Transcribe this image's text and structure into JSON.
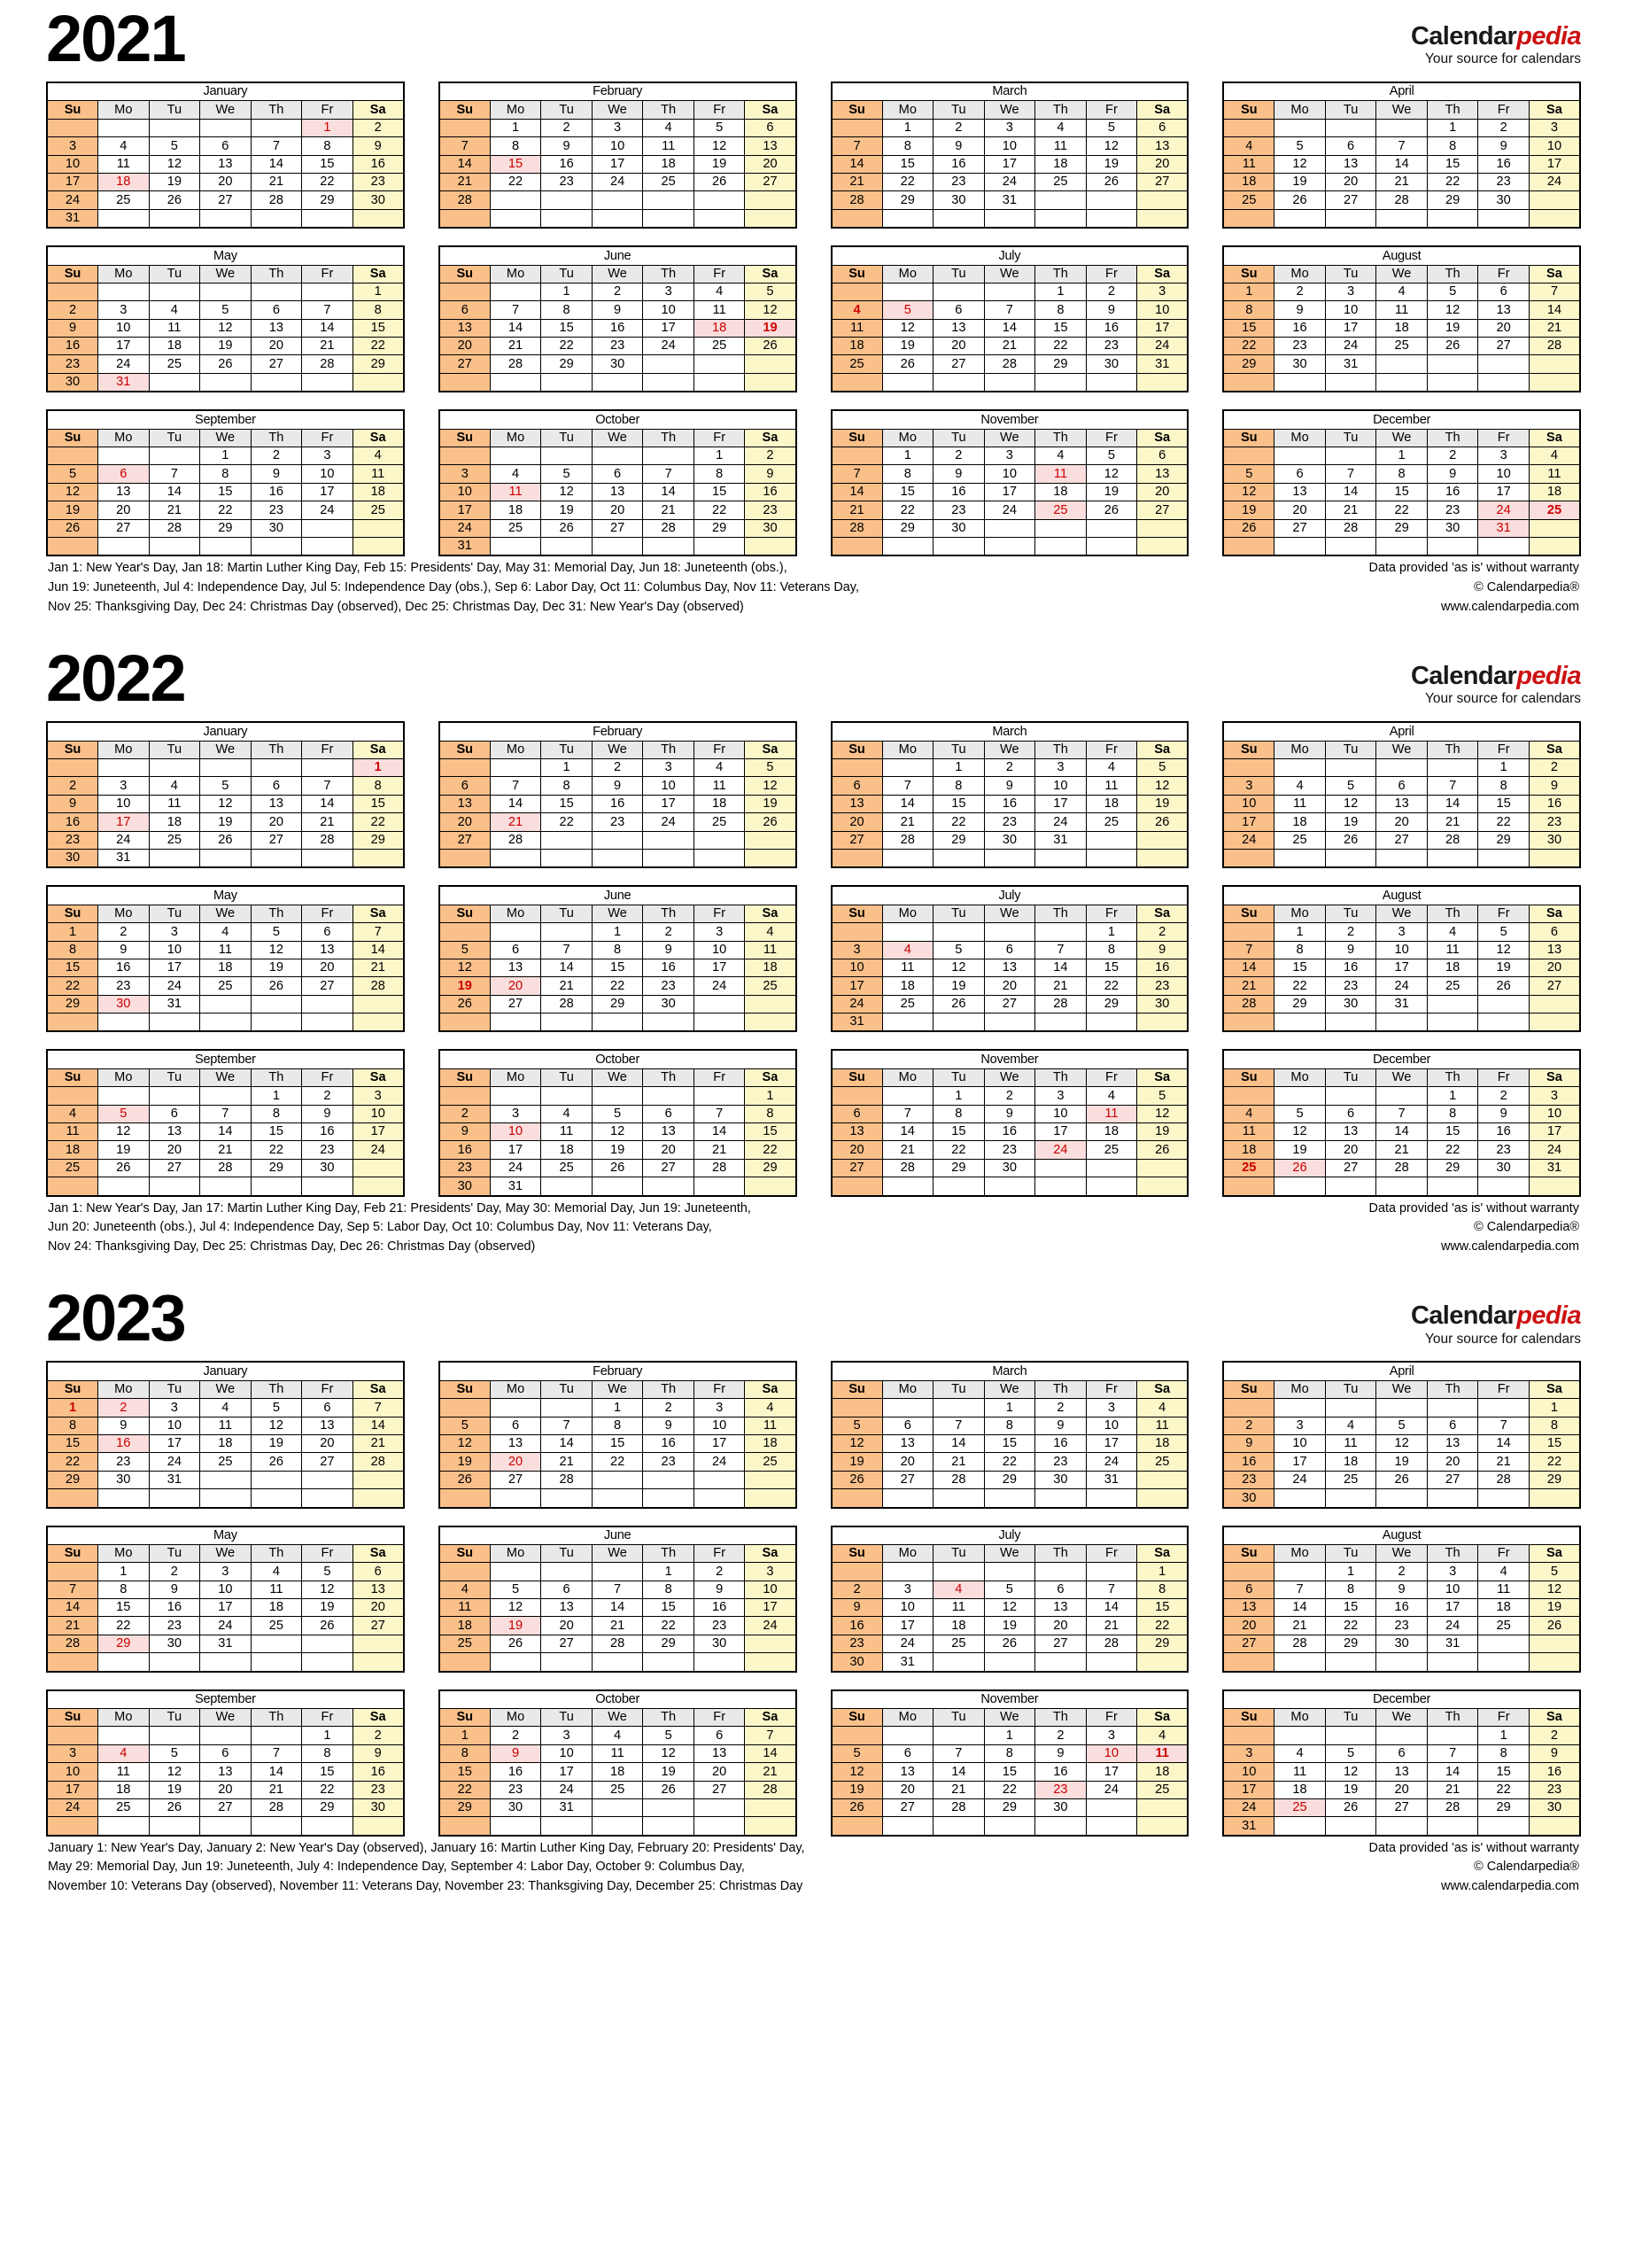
{
  "brand": {
    "name_part1": "Calendar",
    "name_part2": "pedia",
    "tagline": "Your source for calendars"
  },
  "copyright": {
    "line1": "Data provided 'as is' without warranty",
    "line2": "© Calendarpedia®",
    "line3": "www.calendarpedia.com"
  },
  "dow": [
    "Su",
    "Mo",
    "Tu",
    "We",
    "Th",
    "Fr",
    "Sa"
  ],
  "colors": {
    "sunday_bg": "#fac08a",
    "saturday_bg": "#fbf7c9",
    "weekday_header_bg": "#e9e9e9",
    "holiday_bg": "#fadede",
    "holiday_text": "#cc0000",
    "brand_red": "#cc1111"
  },
  "years": [
    {
      "year": "2021",
      "footer_lines": [
        "Jan 1: New Year's Day, Jan 18: Martin Luther King Day, Feb 15: Presidents' Day, May 31: Memorial Day, Jun 18: Juneteenth (obs.),",
        "Jun 19: Juneteenth, Jul 4: Independence Day, Jul 5: Independence Day (obs.), Sep 6: Labor Day, Oct 11: Columbus Day, Nov 11: Veterans Day,",
        "Nov 25: Thanksgiving Day, Dec 24: Christmas Day (observed), Dec 25: Christmas Day, Dec 31: New Year's Day (observed)"
      ],
      "months": [
        {
          "name": "January",
          "start": 5,
          "days": 31,
          "holidays": [
            1,
            18
          ]
        },
        {
          "name": "February",
          "start": 1,
          "days": 28,
          "holidays": [
            15
          ]
        },
        {
          "name": "March",
          "start": 1,
          "days": 31,
          "holidays": []
        },
        {
          "name": "April",
          "start": 4,
          "days": 30,
          "holidays": []
        },
        {
          "name": "May",
          "start": 6,
          "days": 31,
          "holidays": [
            31
          ]
        },
        {
          "name": "June",
          "start": 2,
          "days": 30,
          "holidays": [
            18,
            19
          ]
        },
        {
          "name": "July",
          "start": 4,
          "days": 31,
          "holidays": [
            4,
            5
          ]
        },
        {
          "name": "August",
          "start": 0,
          "days": 31,
          "holidays": []
        },
        {
          "name": "September",
          "start": 3,
          "days": 30,
          "holidays": [
            6
          ]
        },
        {
          "name": "October",
          "start": 5,
          "days": 31,
          "holidays": [
            11
          ]
        },
        {
          "name": "November",
          "start": 1,
          "days": 30,
          "holidays": [
            11,
            25
          ]
        },
        {
          "name": "December",
          "start": 3,
          "days": 31,
          "holidays": [
            24,
            25,
            31
          ]
        }
      ]
    },
    {
      "year": "2022",
      "footer_lines": [
        "Jan 1: New Year's Day, Jan 17: Martin Luther King Day, Feb 21: Presidents' Day, May 30: Memorial Day, Jun 19: Juneteenth,",
        "Jun 20: Juneteenth (obs.), Jul 4: Independence Day, Sep 5: Labor Day, Oct 10: Columbus Day, Nov 11: Veterans Day,",
        "Nov 24: Thanksgiving Day, Dec 25: Christmas Day, Dec 26: Christmas Day (observed)"
      ],
      "months": [
        {
          "name": "January",
          "start": 6,
          "days": 31,
          "holidays": [
            1,
            17
          ]
        },
        {
          "name": "February",
          "start": 2,
          "days": 28,
          "holidays": [
            21
          ]
        },
        {
          "name": "March",
          "start": 2,
          "days": 31,
          "holidays": []
        },
        {
          "name": "April",
          "start": 5,
          "days": 30,
          "holidays": []
        },
        {
          "name": "May",
          "start": 0,
          "days": 31,
          "holidays": [
            30
          ]
        },
        {
          "name": "June",
          "start": 3,
          "days": 30,
          "holidays": [
            19,
            20
          ]
        },
        {
          "name": "July",
          "start": 5,
          "days": 31,
          "holidays": [
            4
          ]
        },
        {
          "name": "August",
          "start": 1,
          "days": 31,
          "holidays": []
        },
        {
          "name": "September",
          "start": 4,
          "days": 30,
          "holidays": [
            5
          ]
        },
        {
          "name": "October",
          "start": 6,
          "days": 31,
          "holidays": [
            10
          ]
        },
        {
          "name": "November",
          "start": 2,
          "days": 30,
          "holidays": [
            11,
            24
          ]
        },
        {
          "name": "December",
          "start": 4,
          "days": 31,
          "holidays": [
            25,
            26
          ]
        }
      ]
    },
    {
      "year": "2023",
      "footer_lines": [
        "January 1: New Year's Day, January 2: New Year's Day (observed), January 16: Martin Luther King Day, February 20: Presidents' Day,",
        "May 29: Memorial Day, Jun 19: Juneteenth, July 4: Independence Day, September 4: Labor Day, October 9: Columbus Day,",
        "November 10: Veterans Day (observed), November 11: Veterans Day, November 23: Thanksgiving Day, December 25: Christmas Day"
      ],
      "months": [
        {
          "name": "January",
          "start": 0,
          "days": 31,
          "holidays": [
            1,
            2,
            16
          ]
        },
        {
          "name": "February",
          "start": 3,
          "days": 28,
          "holidays": [
            20
          ]
        },
        {
          "name": "March",
          "start": 3,
          "days": 31,
          "holidays": []
        },
        {
          "name": "April",
          "start": 6,
          "days": 30,
          "holidays": []
        },
        {
          "name": "May",
          "start": 1,
          "days": 31,
          "holidays": [
            29
          ]
        },
        {
          "name": "June",
          "start": 4,
          "days": 30,
          "holidays": [
            19
          ]
        },
        {
          "name": "July",
          "start": 6,
          "days": 31,
          "holidays": [
            4
          ]
        },
        {
          "name": "August",
          "start": 2,
          "days": 31,
          "holidays": []
        },
        {
          "name": "September",
          "start": 5,
          "days": 30,
          "holidays": [
            4
          ]
        },
        {
          "name": "October",
          "start": 0,
          "days": 31,
          "holidays": [
            9
          ]
        },
        {
          "name": "November",
          "start": 3,
          "days": 30,
          "holidays": [
            10,
            11,
            23
          ]
        },
        {
          "name": "December",
          "start": 5,
          "days": 31,
          "holidays": [
            25
          ]
        }
      ]
    }
  ]
}
